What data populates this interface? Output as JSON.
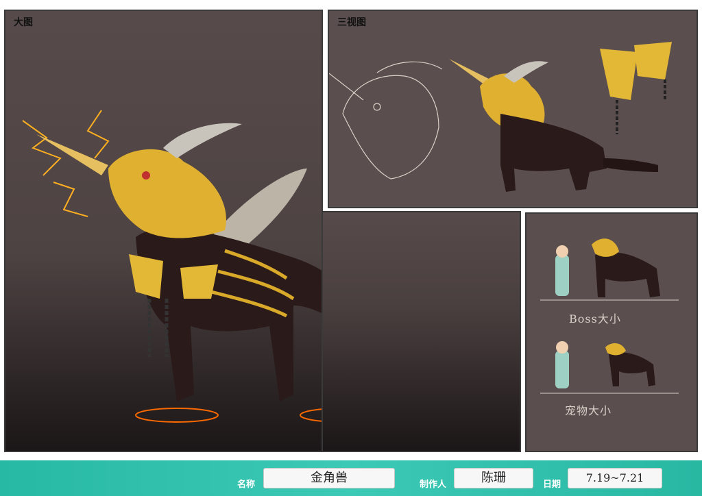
{
  "panels": {
    "main": {
      "title": "大图"
    },
    "three_view": {
      "title": "三视图"
    },
    "scale": {
      "boss_label": "Boss大小",
      "pet_label": "宠物大小"
    }
  },
  "footer": {
    "name_label": "名称",
    "name_value": "金角兽",
    "author_label": "制作人",
    "author_value": "陈珊",
    "date_label": "日期",
    "date_value": "7.19~7.21"
  },
  "colors": {
    "panel_bg": "#5b4e4e",
    "footer_bg": "#3cc9b6",
    "gold": "#e0b030",
    "dark_body": "#2a1a1a"
  }
}
